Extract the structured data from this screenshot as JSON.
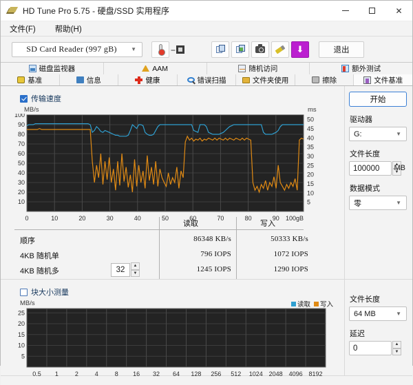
{
  "window": {
    "title": "HD Tune Pro 5.75 - 硬盘/SSD 实用程序",
    "app_icon": "disk-stack-icon",
    "minimize": "–",
    "maximize": "□",
    "close": "✕"
  },
  "menu": [
    {
      "label": "文件(F)",
      "name": "menu-file"
    },
    {
      "label": "帮助(H)",
      "name": "menu-help"
    }
  ],
  "toolbar": {
    "drive": "SD Card Reader (997 gB)",
    "temperature": "--",
    "buttons": [
      {
        "name": "copy-icon",
        "icon": "copy-icon"
      },
      {
        "name": "copy-graph-icon",
        "icon": "copy-graph-icon"
      },
      {
        "name": "screenshot-icon",
        "icon": "camera-icon"
      },
      {
        "name": "pencil-icon",
        "icon": "pencil-icon"
      },
      {
        "name": "download-icon",
        "icon": "download-arrow-icon"
      }
    ],
    "exit_label": "退出"
  },
  "tabs_top": [
    {
      "label": "磁盘监视器",
      "icon": "monitor-icon"
    },
    {
      "label": "AAM",
      "icon": "aam-icon"
    },
    {
      "label": "随机访问",
      "icon": "random-access-icon"
    },
    {
      "label": "额外测试",
      "icon": "extra-tests-icon"
    }
  ],
  "tabs_bottom": [
    {
      "label": "基准",
      "icon": "benchmark-icon",
      "active": false
    },
    {
      "label": "信息",
      "icon": "info-icon",
      "active": false
    },
    {
      "label": "健康",
      "icon": "health-icon",
      "active": false
    },
    {
      "label": "错误扫描",
      "icon": "error-scan-icon",
      "active": false
    },
    {
      "label": "文件夹使用",
      "icon": "folder-icon",
      "active": false
    },
    {
      "label": "擦除",
      "icon": "erase-icon",
      "active": false
    },
    {
      "label": "文件基准",
      "icon": "file-benchmark-icon",
      "active": true
    }
  ],
  "transfer": {
    "checkbox_label": "传输速度",
    "checked": true
  },
  "block": {
    "checkbox_label": "块大小测量",
    "checked": false
  },
  "results": {
    "col_read": "读取",
    "col_write": "写入",
    "rows": [
      {
        "label": "顺序",
        "read": "86348 KB/s",
        "write": "50333 KB/s"
      },
      {
        "label": "4KB 随机单",
        "read": "796 IOPS",
        "write": "1072 IOPS"
      },
      {
        "label": "4KB 随机多",
        "read": "1245 IOPS",
        "write": "1290 IOPS"
      }
    ],
    "queue_depth": "32"
  },
  "controls_top": {
    "start_label": "开始",
    "drive_label": "驱动器",
    "drive_value": "G:",
    "filelen_label": "文件长度",
    "filelen_value": "100000",
    "filelen_unit": "MB",
    "pattern_label": "数据模式",
    "pattern_value": "零"
  },
  "controls_bottom": {
    "filelen_label": "文件长度",
    "filelen_value": "64 MB",
    "delay_label": "延迟",
    "delay_value": "0"
  },
  "colors": {
    "read": "#2f9fd0",
    "write": "#e08a14",
    "graph_bg": "#232323",
    "accent": "#bb1fd0"
  },
  "chart_data": [
    {
      "type": "line",
      "name": "transfer-rate-chart",
      "title": "传输速度",
      "ylabel": "MB/s",
      "y2label": "ms",
      "xlabel": "100gB",
      "xticks": [
        "0",
        "10",
        "20",
        "30",
        "40",
        "50",
        "60",
        "70",
        "80",
        "90",
        "100gB"
      ],
      "yticks": [
        100,
        90,
        80,
        70,
        60,
        50,
        40,
        30,
        20,
        10
      ],
      "ylim": [
        0,
        100
      ],
      "y2ticks": [
        50,
        45,
        40,
        35,
        30,
        25,
        20,
        15,
        10,
        5
      ],
      "y2lim": [
        0,
        52.5
      ],
      "grid": true,
      "series": [
        {
          "name": "读取",
          "color": "#2f9fd0",
          "axis": "left",
          "values": [
            89,
            90,
            90,
            90,
            91,
            91,
            91,
            91,
            91,
            91,
            91,
            91,
            91,
            91,
            91,
            91,
            91,
            91,
            91,
            91,
            91,
            91,
            91,
            91,
            91,
            91,
            91,
            91,
            91,
            91,
            90,
            82,
            84,
            88,
            86,
            83,
            82,
            84,
            83,
            82,
            81,
            80,
            79,
            79,
            78,
            78,
            78,
            78,
            79,
            84,
            90,
            88,
            86,
            90,
            90,
            89,
            82,
            80,
            79,
            79,
            80,
            84,
            88,
            90,
            90,
            90,
            90,
            90,
            90,
            90,
            90,
            90,
            90,
            90,
            90,
            90,
            90,
            90,
            90,
            84,
            83,
            82,
            90,
            90,
            90,
            88,
            82,
            81,
            80,
            80,
            80,
            80,
            81,
            82,
            84,
            86,
            88,
            89,
            90,
            90,
            90,
            90,
            90,
            90,
            90,
            90,
            90,
            90,
            90,
            90,
            90,
            90,
            82,
            80,
            80,
            80,
            80,
            81,
            82,
            84,
            88,
            90,
            90,
            90,
            90,
            90,
            90,
            90,
            90,
            90,
            90,
            90
          ]
        },
        {
          "name": "写入",
          "color": "#e08a14",
          "axis": "left",
          "values": [
            85,
            85,
            85,
            85,
            85,
            85,
            86,
            85,
            85,
            85,
            85,
            85,
            85,
            85,
            85,
            85,
            85,
            85,
            85,
            85,
            85,
            85,
            85,
            85,
            85,
            85,
            85,
            85,
            85,
            85,
            85,
            52,
            30,
            48,
            35,
            60,
            28,
            52,
            33,
            56,
            30,
            44,
            22,
            52,
            27,
            60,
            31,
            46,
            25,
            38,
            20,
            54,
            26,
            48,
            30,
            42,
            24,
            58,
            32,
            46,
            28,
            52,
            26,
            44,
            35,
            30,
            26,
            40,
            28,
            35,
            30,
            46,
            24,
            42,
            35,
            72,
            78,
            74,
            76,
            73,
            75,
            74,
            76,
            73,
            75,
            74,
            76,
            75,
            74,
            76,
            74,
            76,
            75,
            74,
            76,
            74,
            76,
            75,
            74,
            76,
            75,
            74,
            76,
            74,
            76,
            75,
            74,
            30,
            22,
            26,
            20,
            28,
            24,
            32,
            22,
            30,
            26,
            36,
            24,
            48,
            30,
            26,
            22,
            28,
            24,
            30,
            26,
            34,
            22,
            74,
            76,
            75
          ]
        }
      ]
    },
    {
      "type": "line",
      "name": "block-size-chart",
      "title": "块大小测量",
      "ylabel": "MB/s",
      "yticks": [
        25,
        20,
        15,
        10,
        5
      ],
      "ylim": [
        0,
        27
      ],
      "xticks": [
        "0.5",
        "1",
        "2",
        "4",
        "8",
        "16",
        "32",
        "64",
        "128",
        "256",
        "512",
        "1024",
        "2048",
        "4096",
        "8192"
      ],
      "legend": [
        {
          "label": "读取",
          "color": "#2f9fd0"
        },
        {
          "label": "写入",
          "color": "#e08a14"
        }
      ],
      "grid": true,
      "series": [
        {
          "name": "读取",
          "color": "#2f9fd0",
          "values": []
        },
        {
          "name": "写入",
          "color": "#e08a14",
          "values": []
        }
      ]
    }
  ]
}
